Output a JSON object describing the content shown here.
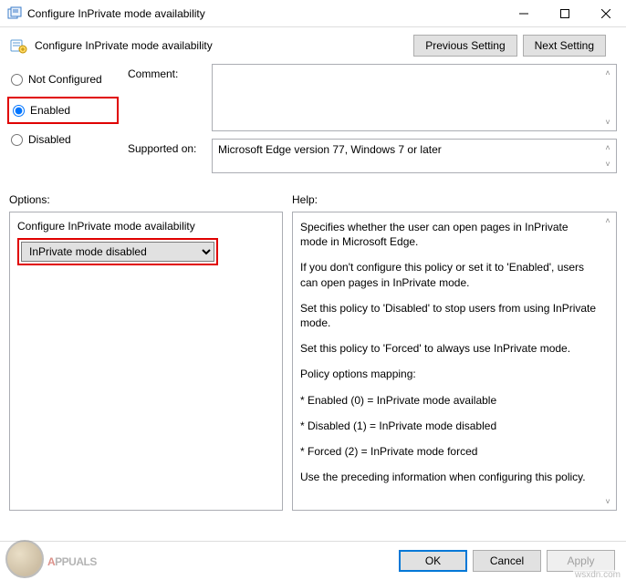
{
  "window": {
    "title": "Configure InPrivate mode availability",
    "minimize": "—",
    "maximize": "☐",
    "close": "✕"
  },
  "subheader": {
    "title": "Configure InPrivate mode availability"
  },
  "nav": {
    "prev": "Previous Setting",
    "next": "Next Setting"
  },
  "state": {
    "not_configured": "Not Configured",
    "enabled": "Enabled",
    "disabled": "Disabled",
    "selected": "enabled"
  },
  "fields": {
    "comment_label": "Comment:",
    "comment_value": "",
    "supported_label": "Supported on:",
    "supported_value": "Microsoft Edge version 77, Windows 7 or later"
  },
  "labels": {
    "options": "Options:",
    "help": "Help:"
  },
  "options": {
    "header": "Configure InPrivate mode availability",
    "select_value": "InPrivate mode disabled"
  },
  "help": {
    "p1": "Specifies whether the user can open pages in InPrivate mode in Microsoft Edge.",
    "p2": "If you don't configure this policy or set it to 'Enabled', users can open pages in InPrivate mode.",
    "p3": "Set this policy to 'Disabled' to stop users from using InPrivate mode.",
    "p4": "Set this policy to 'Forced' to always use InPrivate mode.",
    "p5": "Policy options mapping:",
    "p6": "* Enabled (0) = InPrivate mode available",
    "p7": "* Disabled (1) = InPrivate mode disabled",
    "p8": "* Forced (2) = InPrivate mode forced",
    "p9": "Use the preceding information when configuring this policy."
  },
  "buttons": {
    "ok": "OK",
    "cancel": "Cancel",
    "apply": "Apply"
  },
  "watermark": {
    "brand_prefix": "A",
    "brand_rest": "PPUALS"
  },
  "source": "wsxdn.com"
}
